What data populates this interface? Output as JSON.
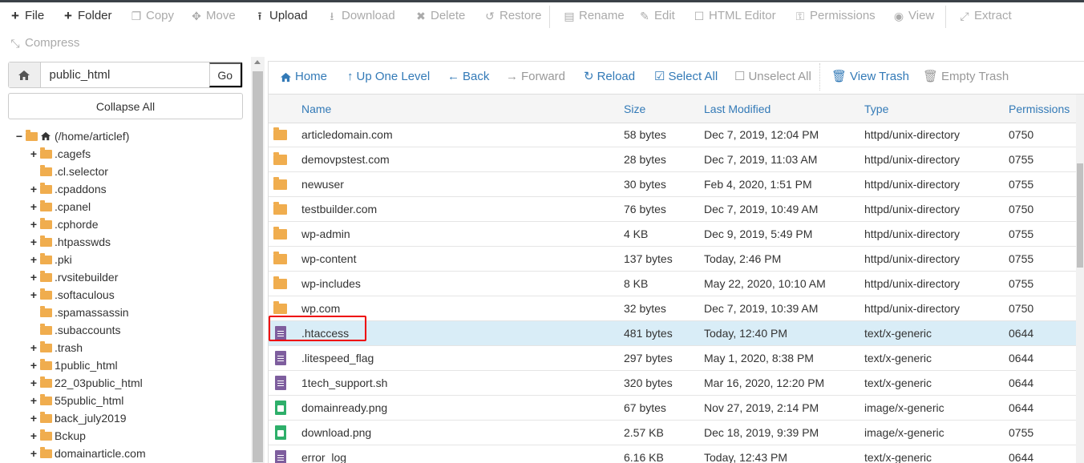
{
  "toolbar": {
    "file": "File",
    "folder": "Folder",
    "copy": "Copy",
    "move": "Move",
    "upload": "Upload",
    "download": "Download",
    "delete": "Delete",
    "restore": "Restore",
    "rename": "Rename",
    "edit": "Edit",
    "html_editor": "HTML Editor",
    "permissions": "Permissions",
    "view": "View",
    "extract": "Extract",
    "compress": "Compress"
  },
  "path": {
    "value": "public_html",
    "go": "Go",
    "collapse_all": "Collapse All"
  },
  "tree": {
    "root": "(/home/articlef)",
    "items": [
      {
        "label": ".cagefs",
        "expandable": true
      },
      {
        "label": ".cl.selector",
        "expandable": false
      },
      {
        "label": ".cpaddons",
        "expandable": true
      },
      {
        "label": ".cpanel",
        "expandable": true
      },
      {
        "label": ".cphorde",
        "expandable": true
      },
      {
        "label": ".htpasswds",
        "expandable": true
      },
      {
        "label": ".pki",
        "expandable": true
      },
      {
        "label": ".rvsitebuilder",
        "expandable": true
      },
      {
        "label": ".softaculous",
        "expandable": true
      },
      {
        "label": ".spamassassin",
        "expandable": false
      },
      {
        "label": ".subaccounts",
        "expandable": false
      },
      {
        "label": ".trash",
        "expandable": true
      },
      {
        "label": "1public_html",
        "expandable": true
      },
      {
        "label": "22_03public_html",
        "expandable": true
      },
      {
        "label": "55public_html",
        "expandable": true
      },
      {
        "label": "back_july2019",
        "expandable": true
      },
      {
        "label": "Bckup",
        "expandable": true
      },
      {
        "label": "domainarticle.com",
        "expandable": true
      }
    ]
  },
  "nav": {
    "home": "Home",
    "up_one_level": "Up One Level",
    "back": "Back",
    "forward": "Forward",
    "reload": "Reload",
    "select_all": "Select All",
    "unselect_all": "Unselect All",
    "view_trash": "View Trash",
    "empty_trash": "Empty Trash"
  },
  "table": {
    "headers": {
      "name": "Name",
      "size": "Size",
      "last_modified": "Last Modified",
      "type": "Type",
      "permissions": "Permissions"
    },
    "rows": [
      {
        "icon": "folder-icon",
        "name": "articledomain.com",
        "size": "58 bytes",
        "modified": "Dec 7, 2019, 12:04 PM",
        "type": "httpd/unix-directory",
        "perms": "0750"
      },
      {
        "icon": "folder-icon",
        "name": "demovpstest.com",
        "size": "28 bytes",
        "modified": "Dec 7, 2019, 11:03 AM",
        "type": "httpd/unix-directory",
        "perms": "0755"
      },
      {
        "icon": "folder-icon",
        "name": "newuser",
        "size": "30 bytes",
        "modified": "Feb 4, 2020, 1:51 PM",
        "type": "httpd/unix-directory",
        "perms": "0755"
      },
      {
        "icon": "folder-icon",
        "name": "testbuilder.com",
        "size": "76 bytes",
        "modified": "Dec 7, 2019, 10:49 AM",
        "type": "httpd/unix-directory",
        "perms": "0750"
      },
      {
        "icon": "folder-icon",
        "name": "wp-admin",
        "size": "4 KB",
        "modified": "Dec 9, 2019, 5:49 PM",
        "type": "httpd/unix-directory",
        "perms": "0755"
      },
      {
        "icon": "folder-icon",
        "name": "wp-content",
        "size": "137 bytes",
        "modified": "Today, 2:46 PM",
        "type": "httpd/unix-directory",
        "perms": "0755"
      },
      {
        "icon": "folder-icon",
        "name": "wp-includes",
        "size": "8 KB",
        "modified": "May 22, 2020, 10:10 AM",
        "type": "httpd/unix-directory",
        "perms": "0755"
      },
      {
        "icon": "folder-icon",
        "name": "wp.com",
        "size": "32 bytes",
        "modified": "Dec 7, 2019, 10:39 AM",
        "type": "httpd/unix-directory",
        "perms": "0750"
      },
      {
        "icon": "text-file-icon",
        "name": ".htaccess",
        "size": "481 bytes",
        "modified": "Today, 12:40 PM",
        "type": "text/x-generic",
        "perms": "0644",
        "selected": true
      },
      {
        "icon": "text-file-icon",
        "name": ".litespeed_flag",
        "size": "297 bytes",
        "modified": "May 1, 2020, 8:38 PM",
        "type": "text/x-generic",
        "perms": "0644"
      },
      {
        "icon": "text-file-icon",
        "name": "1tech_support.sh",
        "size": "320 bytes",
        "modified": "Mar 16, 2020, 12:20 PM",
        "type": "text/x-generic",
        "perms": "0644"
      },
      {
        "icon": "image-file-icon",
        "name": "domainready.png",
        "size": "67 bytes",
        "modified": "Nov 27, 2019, 2:14 PM",
        "type": "image/x-generic",
        "perms": "0644"
      },
      {
        "icon": "image-file-icon",
        "name": "download.png",
        "size": "2.57 KB",
        "modified": "Dec 18, 2019, 9:39 PM",
        "type": "image/x-generic",
        "perms": "0755"
      },
      {
        "icon": "text-file-icon",
        "name": "error_log",
        "size": "6.16 KB",
        "modified": "Today, 12:43 PM",
        "type": "text/x-generic",
        "perms": "0644"
      }
    ]
  },
  "colors": {
    "link": "#337ab7",
    "folder": "#f0ad4e",
    "text_file": "#7e5e9e",
    "image_file": "#2eaf6a",
    "selected_row": "#d9edf7",
    "highlight": "#e00000"
  }
}
